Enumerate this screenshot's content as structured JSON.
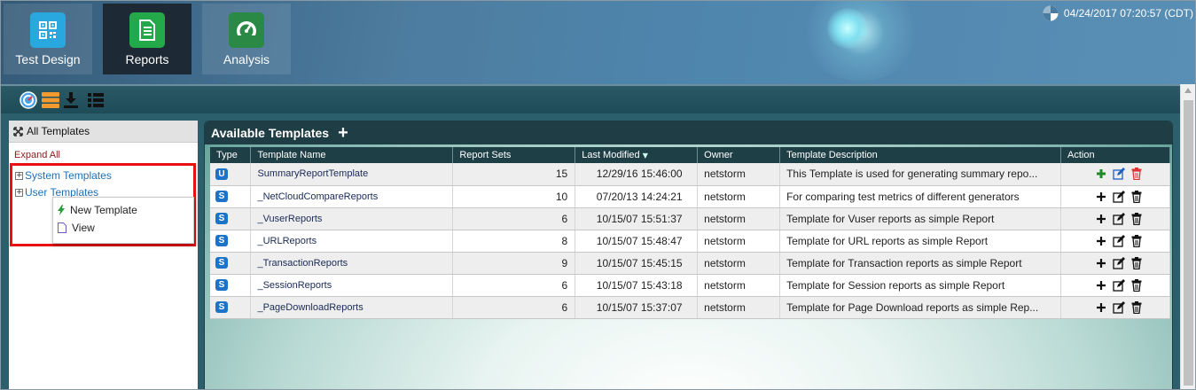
{
  "nav": {
    "tabs": [
      {
        "label": "Test Design",
        "icon": "qr-code-icon",
        "color": "#29a8e0"
      },
      {
        "label": "Reports",
        "icon": "report-document-icon",
        "color": "#23a84a"
      },
      {
        "label": "Analysis",
        "icon": "speedometer-icon",
        "color": "#2a8a45"
      }
    ],
    "active_tab": "Reports"
  },
  "datetime": "04/24/2017 07:20:57 (CDT)",
  "toolbar": {
    "icons": [
      "dashboard-gauge-icon",
      "database-icon",
      "download-icon",
      "list-view-icon"
    ]
  },
  "left_panel": {
    "header": "All Templates",
    "expand_all": "Expand All",
    "tree": [
      "System Templates",
      "User Templates"
    ],
    "context_menu": [
      "New Template",
      "View"
    ]
  },
  "templates": {
    "title": "Available Templates",
    "columns": [
      "Type",
      "Template Name",
      "Report Sets",
      "Last Modified",
      "Owner",
      "Template Description",
      "Action"
    ],
    "sort_column": "Last Modified",
    "rows": [
      {
        "type": "U",
        "name": "SummaryReportTemplate",
        "report_sets": "15",
        "modified": "12/29/16 15:46:00",
        "owner": "netstorm",
        "desc": "This Template is used for generating summary repo...",
        "actions_style": "colored"
      },
      {
        "type": "S",
        "name": "_NetCloudCompareReports",
        "report_sets": "10",
        "modified": "07/20/13 14:24:21",
        "owner": "netstorm",
        "desc": "For comparing test metrics of different generators",
        "actions_style": "plain"
      },
      {
        "type": "S",
        "name": "_VuserReports",
        "report_sets": "6",
        "modified": "10/15/07 15:51:37",
        "owner": "netstorm",
        "desc": "Template for Vuser reports as simple Report",
        "actions_style": "plain"
      },
      {
        "type": "S",
        "name": "_URLReports",
        "report_sets": "8",
        "modified": "10/15/07 15:48:47",
        "owner": "netstorm",
        "desc": "Template for URL reports as simple Report",
        "actions_style": "plain"
      },
      {
        "type": "S",
        "name": "_TransactionReports",
        "report_sets": "9",
        "modified": "10/15/07 15:45:15",
        "owner": "netstorm",
        "desc": "Template for Transaction reports as simple Report",
        "actions_style": "plain"
      },
      {
        "type": "S",
        "name": "_SessionReports",
        "report_sets": "6",
        "modified": "10/15/07 15:43:18",
        "owner": "netstorm",
        "desc": "Template for Session reports as simple Report",
        "actions_style": "plain"
      },
      {
        "type": "S",
        "name": "_PageDownloadReports",
        "report_sets": "6",
        "modified": "10/15/07 15:37:07",
        "owner": "netstorm",
        "desc": "Template for Page Download reports as simple Rep...",
        "actions_style": "plain"
      }
    ]
  }
}
